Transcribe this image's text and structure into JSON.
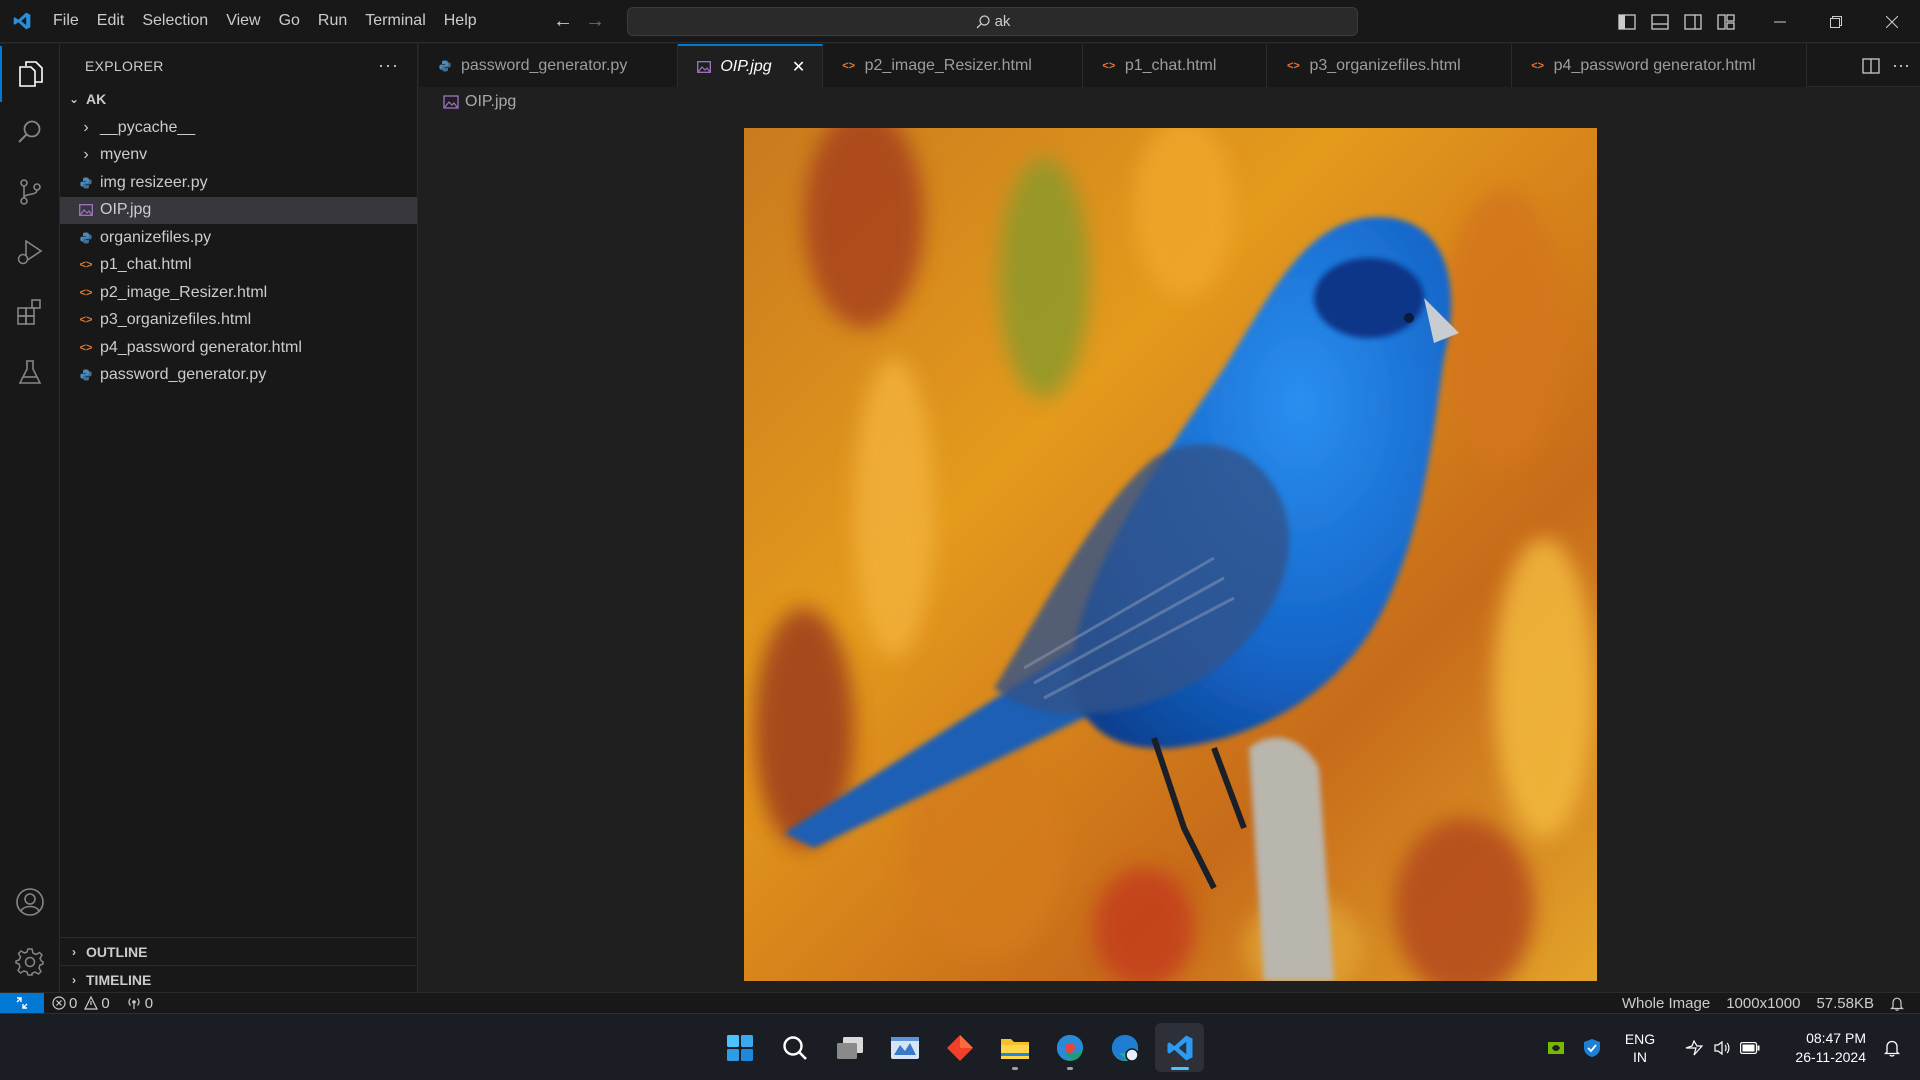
{
  "menu": [
    "File",
    "Edit",
    "Selection",
    "View",
    "Go",
    "Run",
    "Terminal",
    "Help"
  ],
  "search": {
    "text": "ak"
  },
  "explorer": {
    "title": "EXPLORER",
    "more": "···",
    "folder": "AK",
    "items": [
      {
        "label": "__pycache__",
        "type": "folder"
      },
      {
        "label": "myenv",
        "type": "folder"
      },
      {
        "label": "img resizeer.py",
        "type": "py"
      },
      {
        "label": "OIP.jpg",
        "type": "img"
      },
      {
        "label": "organizefiles.py",
        "type": "py"
      },
      {
        "label": "p1_chat.html",
        "type": "html"
      },
      {
        "label": "p2_image_Resizer.html",
        "type": "html"
      },
      {
        "label": "p3_organizefiles.html",
        "type": "html"
      },
      {
        "label": "p4_password generator.html",
        "type": "html"
      },
      {
        "label": "password_generator.py",
        "type": "py"
      }
    ],
    "outline": "OUTLINE",
    "timeline": "TIMELINE"
  },
  "tabs": [
    {
      "label": "password_generator.py",
      "type": "py"
    },
    {
      "label": "OIP.jpg",
      "type": "img"
    },
    {
      "label": "p2_image_Resizer.html",
      "type": "html"
    },
    {
      "label": "p1_chat.html",
      "type": "html"
    },
    {
      "label": "p3_organizefiles.html",
      "type": "html"
    },
    {
      "label": "p4_password generator.html",
      "type": "html"
    }
  ],
  "breadcrumb": "OIP.jpg",
  "status": {
    "errors": "0",
    "warnings": "0",
    "ports": "0",
    "zoom": "Whole Image",
    "dimensions": "1000x1000",
    "size": "57.58KB"
  },
  "taskbar": {
    "lang_1": "ENG",
    "lang_2": "IN",
    "time": "08:47 PM",
    "date": "26-11-2024"
  },
  "colors": {
    "accent": "#0078d4",
    "python": "#4b8bbe",
    "html": "#e37933",
    "image": "#a074c4"
  }
}
